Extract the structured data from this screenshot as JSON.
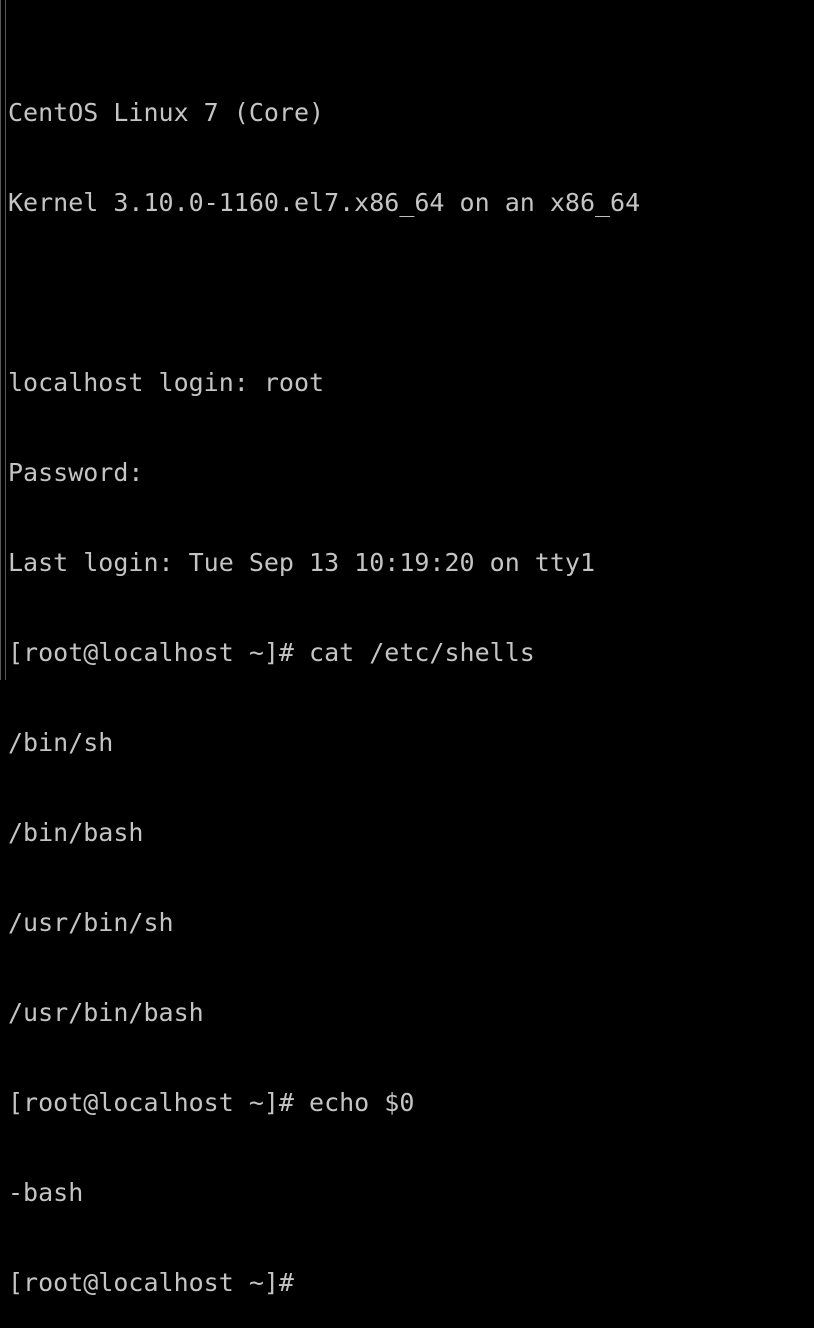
{
  "console": {
    "lines": [
      "CentOS Linux 7 (Core)",
      "Kernel 3.10.0-1160.el7.x86_64 on an x86_64",
      "",
      "localhost login: root",
      "Password:",
      "Last login: Tue Sep 13 10:19:20 on tty1",
      "[root@localhost ~]# cat /etc/shells",
      "/bin/sh",
      "/bin/bash",
      "/usr/bin/sh",
      "/usr/bin/bash",
      "[root@localhost ~]# echo $0",
      "-bash",
      "[root@localhost ~]#"
    ]
  },
  "colors": {
    "background": "#000000",
    "text": "#c4c4c4"
  }
}
